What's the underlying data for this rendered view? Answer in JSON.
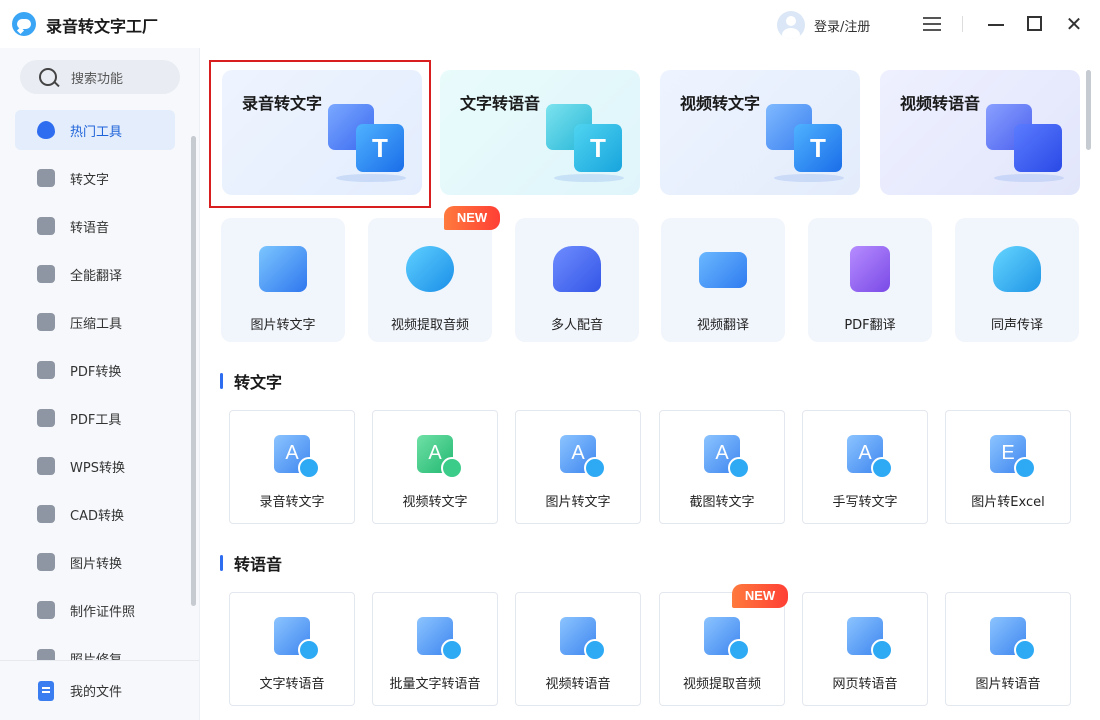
{
  "app": {
    "title": "录音转文字工厂"
  },
  "header": {
    "login_label": "登录/注册"
  },
  "sidebar": {
    "search_placeholder": "搜索功能",
    "items": [
      {
        "label": "热门工具",
        "active": true
      },
      {
        "label": "转文字"
      },
      {
        "label": "转语音"
      },
      {
        "label": "全能翻译"
      },
      {
        "label": "压缩工具"
      },
      {
        "label": "PDF转换"
      },
      {
        "label": "PDF工具"
      },
      {
        "label": "WPS转换"
      },
      {
        "label": "CAD转换"
      },
      {
        "label": "图片转换"
      },
      {
        "label": "制作证件照"
      },
      {
        "label": "照片修复"
      }
    ],
    "footer_label": "我的文件"
  },
  "featured": [
    {
      "title": "录音转文字",
      "glyph": "T",
      "selected": true
    },
    {
      "title": "文字转语音",
      "glyph": "T"
    },
    {
      "title": "视频转文字",
      "glyph": "T"
    },
    {
      "title": "视频转语音",
      "glyph": ""
    }
  ],
  "hot_tools": [
    {
      "label": "图片转文字"
    },
    {
      "label": "视频提取音频",
      "badge": "NEW"
    },
    {
      "label": "多人配音"
    },
    {
      "label": "视频翻译"
    },
    {
      "label": "PDF翻译"
    },
    {
      "label": "同声传译"
    }
  ],
  "sections": [
    {
      "title": "转文字",
      "items": [
        {
          "label": "录音转文字",
          "glyph": "A"
        },
        {
          "label": "视频转文字",
          "glyph": "A"
        },
        {
          "label": "图片转文字",
          "glyph": "A"
        },
        {
          "label": "截图转文字",
          "glyph": "A"
        },
        {
          "label": "手写转文字",
          "glyph": "A"
        },
        {
          "label": "图片转Excel",
          "glyph": "E"
        }
      ]
    },
    {
      "title": "转语音",
      "items": [
        {
          "label": "文字转语音"
        },
        {
          "label": "批量文字转语音"
        },
        {
          "label": "视频转语音"
        },
        {
          "label": "视频提取音频",
          "badge": "NEW"
        },
        {
          "label": "网页转语音"
        },
        {
          "label": "图片转语音"
        }
      ]
    }
  ],
  "colors": {
    "accent": "#2f6df0",
    "badge": "#ff4a36",
    "selection": "#d81e1e"
  }
}
